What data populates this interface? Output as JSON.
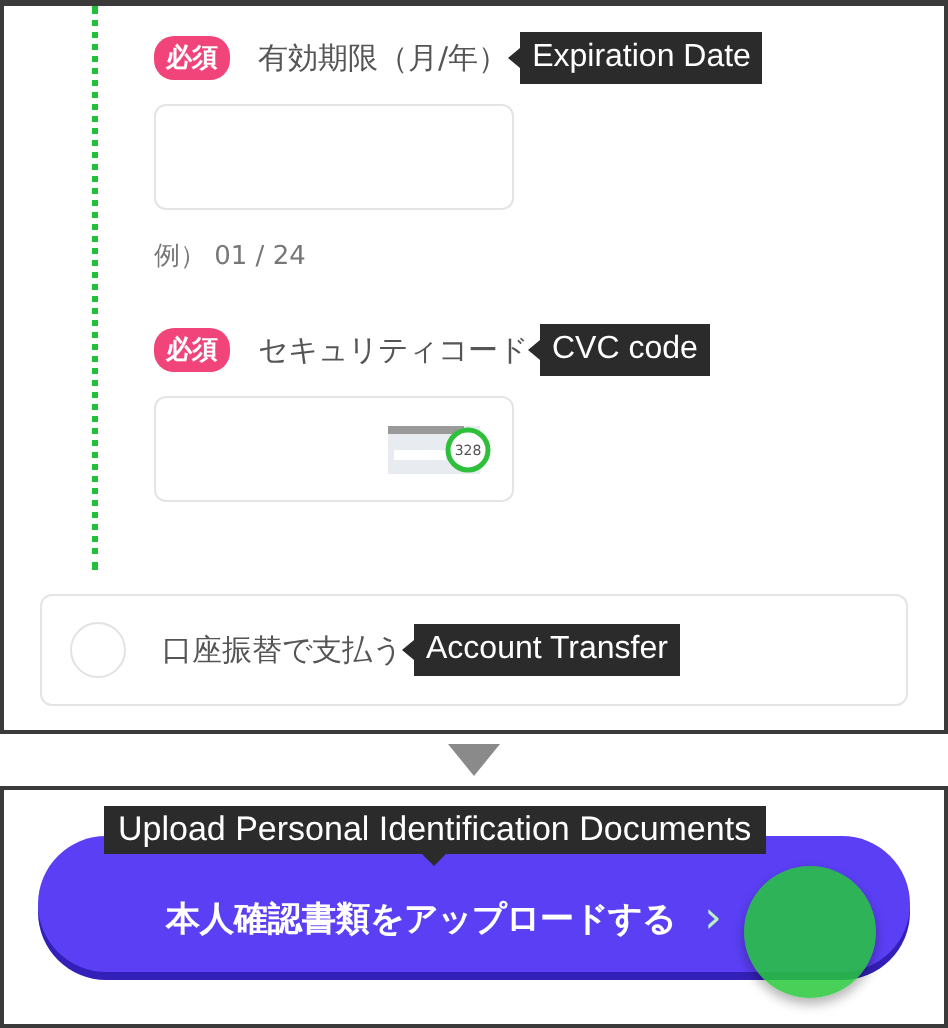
{
  "fields": [
    {
      "required_badge": "必須",
      "label": "有効期限（月/年）",
      "callout": "Expiration Date",
      "kind": "text",
      "hint": "例） 01 / 24"
    },
    {
      "required_badge": "必須",
      "label": "セキュリティコード",
      "callout": "CVC code",
      "kind": "cvc",
      "cvc_sample": "328"
    }
  ],
  "payment_option": {
    "label": "口座振替で支払う",
    "callout": "Account Transfer",
    "selected": false
  },
  "upload_button": {
    "label": "本人確認書類をアップロードする",
    "chevron": "›",
    "callout": "Upload Personal Identification Documents"
  }
}
